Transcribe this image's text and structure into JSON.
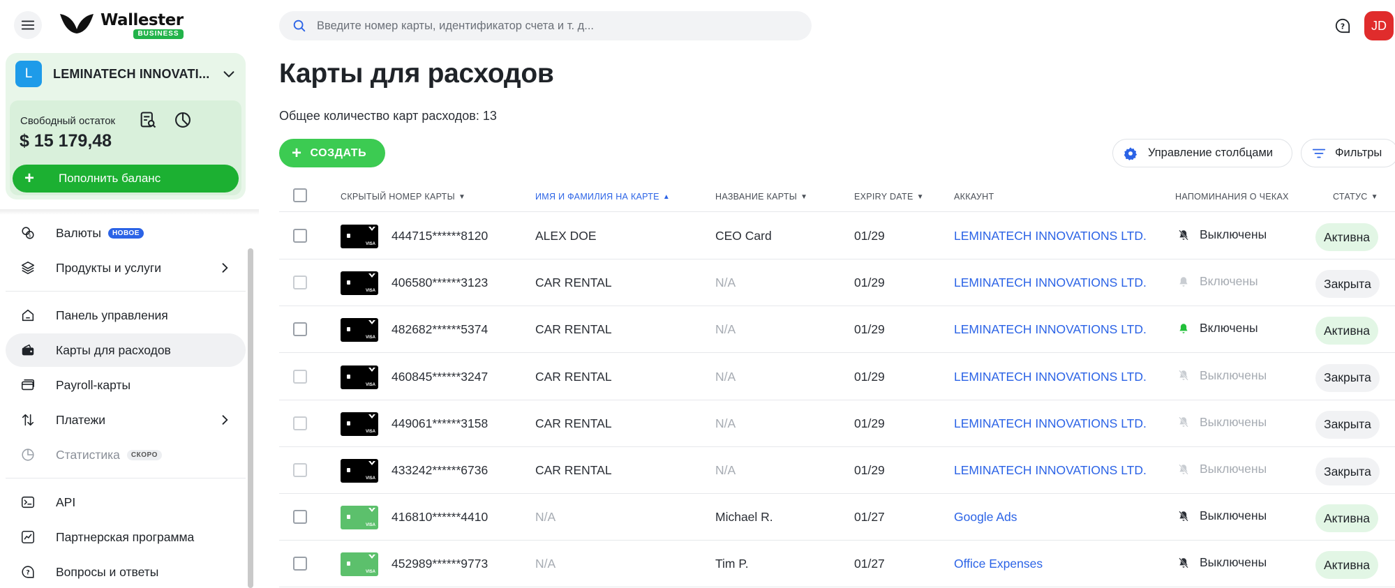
{
  "brand": {
    "name": "Wallester",
    "badge": "BUSINESS"
  },
  "account": {
    "initial": "L",
    "name": "LEMINATECH INNOVATI...",
    "balance_label": "Свободный остаток",
    "balance_value": "$ 15 179,48",
    "topup_label": "Пополнить баланс"
  },
  "nav": {
    "currencies": "Валюты",
    "currencies_badge": "НОВОЕ",
    "products": "Продукты и услуги",
    "dashboard": "Панель управления",
    "expense_cards": "Карты для расходов",
    "payroll": "Payroll-карты",
    "payments": "Платежи",
    "statistics": "Статистика",
    "statistics_badge": "СКОРО",
    "api": "API",
    "partner": "Партнерская программа",
    "faq": "Вопросы и ответы"
  },
  "search": {
    "placeholder": "Введите номер карты, идентификатор счета и т. д..."
  },
  "user": {
    "initials": "JD"
  },
  "page": {
    "title": "Карты для расходов",
    "total": "Общее количество карт расходов: 13",
    "create_label": "СОЗДАТЬ",
    "columns_label": "Управление столбцами",
    "filters_label": "Фильтры"
  },
  "table": {
    "headers": {
      "card_number": "СКРЫТЫЙ НОМЕР КАРТЫ",
      "name_on_card": "ИМЯ И ФАМИЛИЯ НА КАРТЕ",
      "card_name": "НАЗВАНИЕ КАРТЫ",
      "expiry": "EXPIRY DATE",
      "account": "АККАУНТ",
      "reminders": "НАПОМИНАНИЯ О ЧЕКАХ",
      "status": "СТАТУС"
    },
    "rows": [
      {
        "card": "444715******8120",
        "name": "ALEX DOE",
        "card_name": "CEO Card",
        "expiry": "01/29",
        "account": "LEMINATECH INNOVATIONS LTD.",
        "reminder": "Выключены",
        "status": "Активна"
      },
      {
        "card": "406580******3123",
        "name": "CAR RENTAL",
        "card_name": "N/A",
        "expiry": "01/29",
        "account": "LEMINATECH INNOVATIONS LTD.",
        "reminder": "Включены",
        "status": "Закрыта"
      },
      {
        "card": "482682******5374",
        "name": "CAR RENTAL",
        "card_name": "N/A",
        "expiry": "01/29",
        "account": "LEMINATECH INNOVATIONS LTD.",
        "reminder": "Включены",
        "status": "Активна"
      },
      {
        "card": "460845******3247",
        "name": "CAR RENTAL",
        "card_name": "N/A",
        "expiry": "01/29",
        "account": "LEMINATECH INNOVATIONS LTD.",
        "reminder": "Выключены",
        "status": "Закрыта"
      },
      {
        "card": "449061******3158",
        "name": "CAR RENTAL",
        "card_name": "N/A",
        "expiry": "01/29",
        "account": "LEMINATECH INNOVATIONS LTD.",
        "reminder": "Выключены",
        "status": "Закрыта"
      },
      {
        "card": "433242******6736",
        "name": "CAR RENTAL",
        "card_name": "N/A",
        "expiry": "01/29",
        "account": "LEMINATECH INNOVATIONS LTD.",
        "reminder": "Выключены",
        "status": "Закрыта"
      },
      {
        "card": "416810******4410",
        "name": "N/A",
        "card_name": "Michael R.",
        "expiry": "01/27",
        "account": "Google Ads",
        "reminder": "Выключены",
        "status": "Активна"
      },
      {
        "card": "452989******9773",
        "name": "N/A",
        "card_name": "Tim P.",
        "expiry": "01/27",
        "account": "Office Expenses",
        "reminder": "Выключены",
        "status": "Активна"
      }
    ]
  },
  "card_visa_label": "VISA",
  "colors": {
    "accent_green": "#1cb032",
    "link_blue": "#2b63e6",
    "avatar_red": "#e02c2c"
  }
}
